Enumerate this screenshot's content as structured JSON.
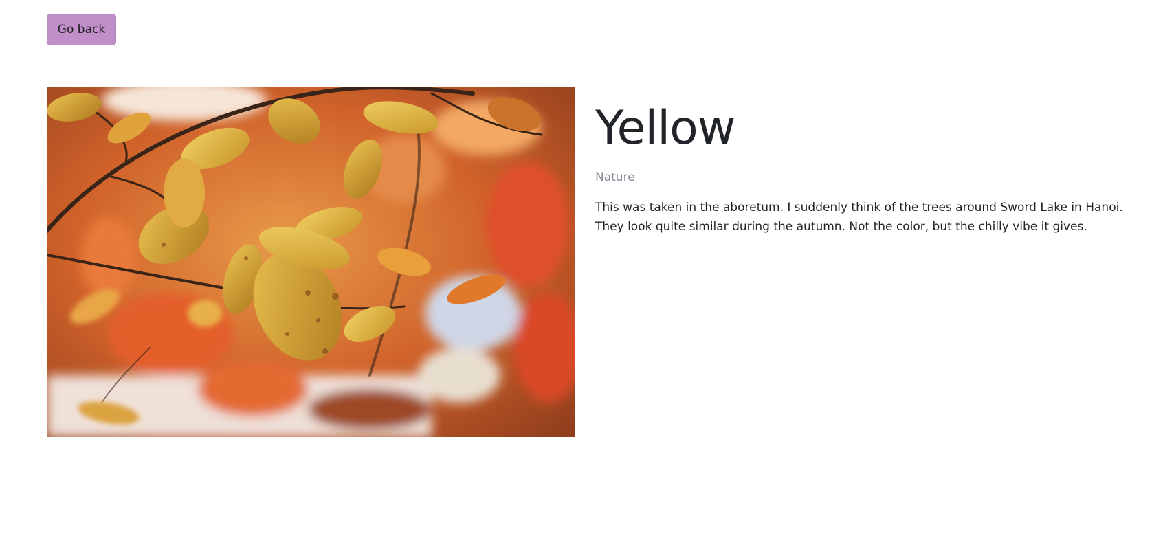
{
  "nav": {
    "back_label": "Go back"
  },
  "post": {
    "title": "Yellow",
    "category": "Nature",
    "description": "This was taken in the aboretum. I suddenly think of the trees around Sword Lake in Hanoi. They look quite similar during the autumn. Not the color, but the chilly vibe it gives."
  },
  "theme": {
    "button_color": "#c08fc9",
    "category_color": "#8f8496"
  },
  "image": {
    "subject": "yellow autumn leaves on branch"
  }
}
